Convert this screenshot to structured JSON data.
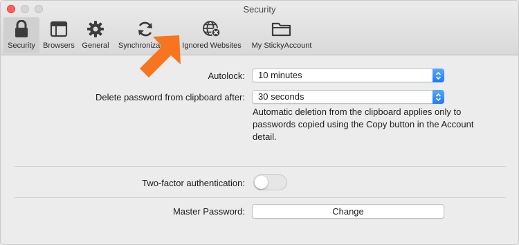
{
  "window": {
    "title": "Security"
  },
  "toolbar": {
    "tabs": [
      {
        "label": "Security",
        "icon": "lock-icon",
        "selected": true
      },
      {
        "label": "Browsers",
        "icon": "browser-window-icon",
        "selected": false
      },
      {
        "label": "General",
        "icon": "gear-icon",
        "selected": false
      },
      {
        "label": "Synchronization",
        "icon": "sync-icon",
        "selected": false
      },
      {
        "label": "Ignored Websites",
        "icon": "globe-blocked-icon",
        "selected": false
      },
      {
        "label": "My StickyAccount",
        "icon": "folder-icon",
        "selected": false
      }
    ]
  },
  "annotation": {
    "icon": "orange-arrow-icon",
    "color": "#f7751e"
  },
  "settings": {
    "autolock": {
      "label": "Autolock:",
      "value": "10 minutes"
    },
    "clipboard": {
      "label": "Delete password from clipboard after:",
      "value": "30 seconds",
      "note": "Automatic deletion from the clipboard applies only to passwords copied using the Copy button in the Account detail."
    },
    "two_factor": {
      "label": "Two-factor authentication:",
      "enabled": false
    },
    "master_password": {
      "label": "Master Password:",
      "button_label": "Change"
    }
  },
  "colors": {
    "accent": "#1c7bf5",
    "close": "#fc5f57"
  }
}
